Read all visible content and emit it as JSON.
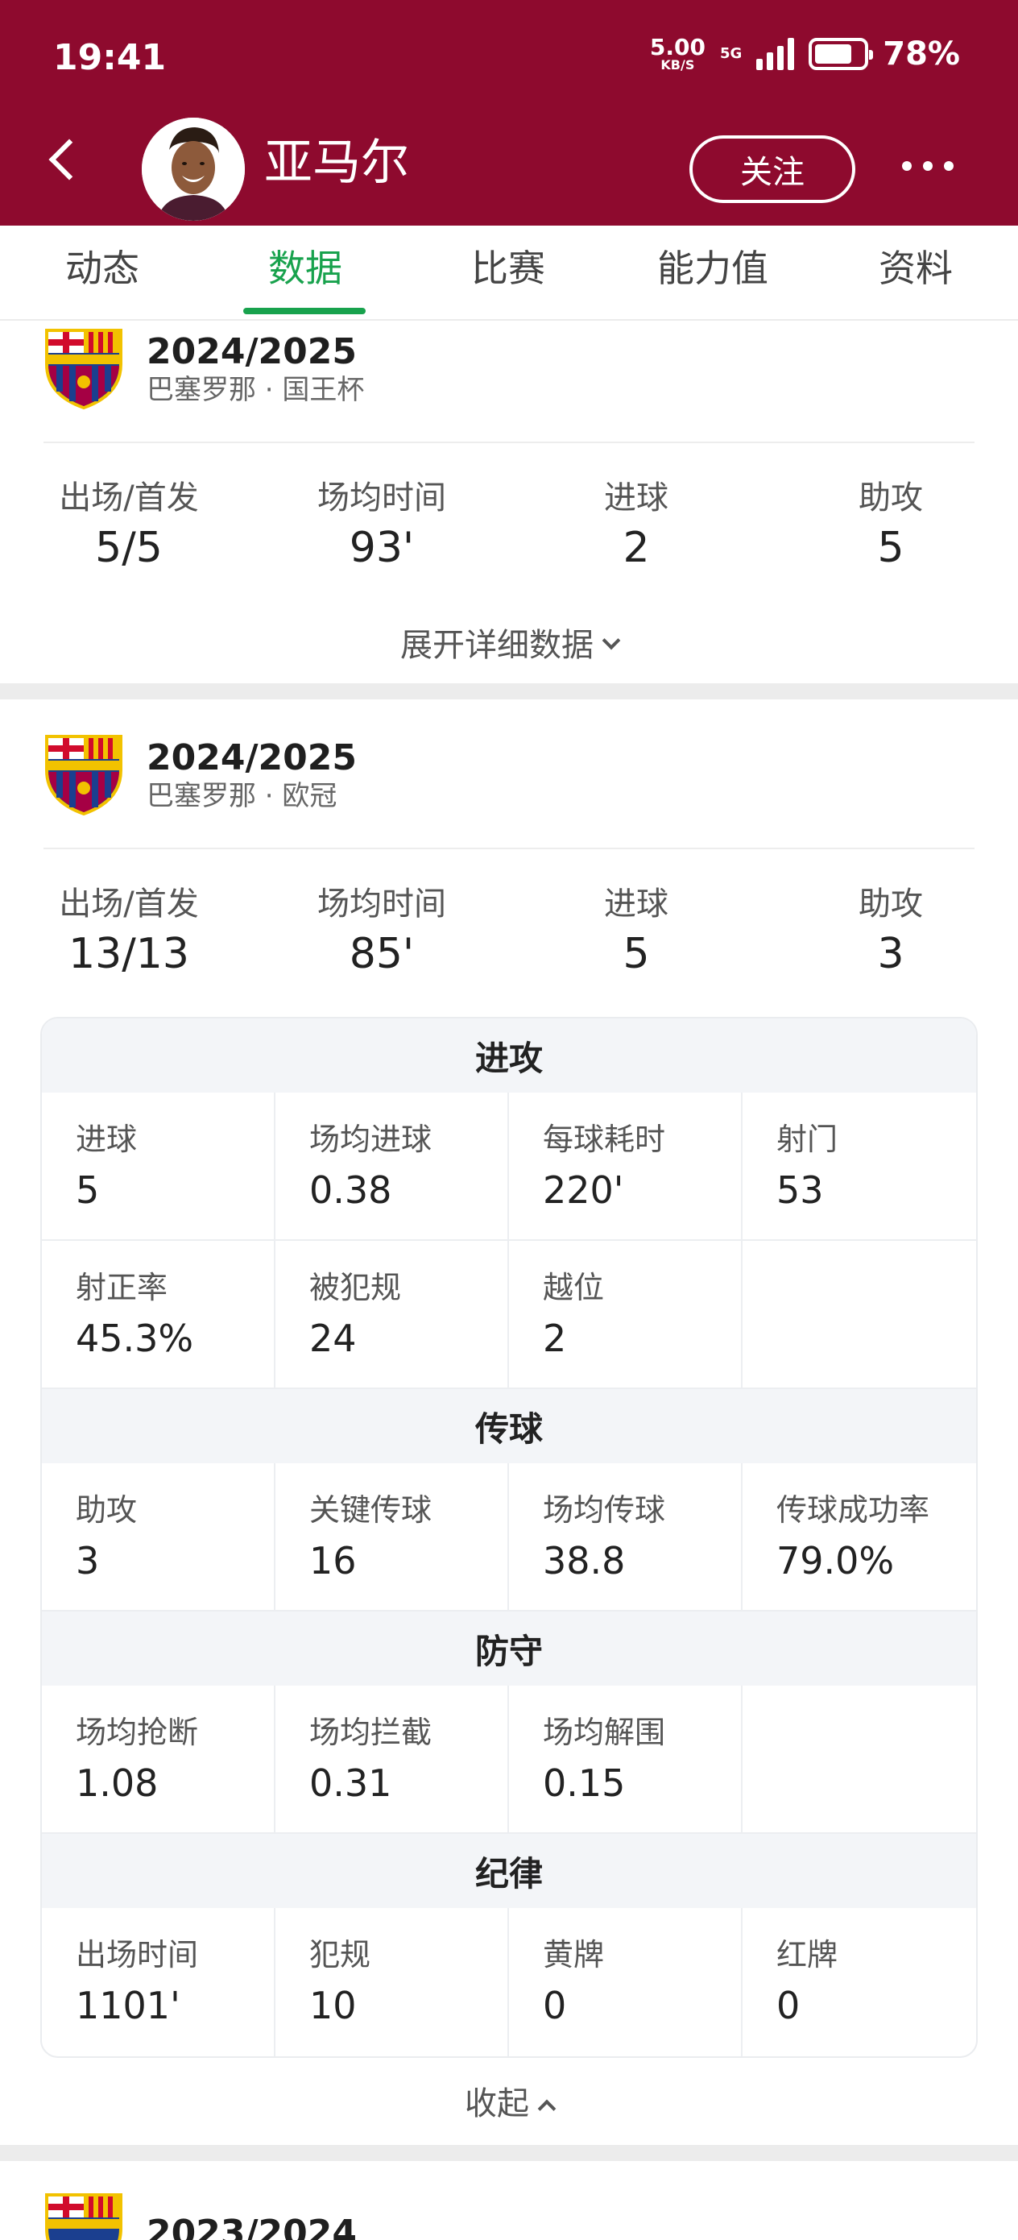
{
  "status_bar": {
    "time": "19:41",
    "net_speed": "5.00",
    "net_unit": "KB/S",
    "net_type": "5G",
    "battery_pct": "78%",
    "battery_level": 0.78
  },
  "header": {
    "player_name": "亚马尔",
    "follow_label": "关注"
  },
  "tabs": [
    {
      "label": "动态"
    },
    {
      "label": "数据"
    },
    {
      "label": "比赛"
    },
    {
      "label": "能力值"
    },
    {
      "label": "资料"
    }
  ],
  "active_tab": "数据",
  "cards": [
    {
      "season": "2024/2025",
      "competition": "巴塞罗那 · 国王杯",
      "summary": [
        {
          "label": "出场/首发",
          "value": "5/5"
        },
        {
          "label": "场均时间",
          "value": "93'"
        },
        {
          "label": "进球",
          "value": "2"
        },
        {
          "label": "助攻",
          "value": "5"
        }
      ],
      "toggle_label": "展开详细数据"
    },
    {
      "season": "2024/2025",
      "competition": "巴塞罗那 · 欧冠",
      "summary": [
        {
          "label": "出场/首发",
          "value": "13/13"
        },
        {
          "label": "场均时间",
          "value": "85'"
        },
        {
          "label": "进球",
          "value": "5"
        },
        {
          "label": "助攻",
          "value": "3"
        }
      ],
      "sections": [
        {
          "title": "进攻",
          "items": [
            {
              "label": "进球",
              "value": "5"
            },
            {
              "label": "场均进球",
              "value": "0.38"
            },
            {
              "label": "每球耗时",
              "value": "220'"
            },
            {
              "label": "射门",
              "value": "53"
            },
            {
              "label": "射正率",
              "value": "45.3%"
            },
            {
              "label": "被犯规",
              "value": "24"
            },
            {
              "label": "越位",
              "value": "2"
            }
          ]
        },
        {
          "title": "传球",
          "items": [
            {
              "label": "助攻",
              "value": "3"
            },
            {
              "label": "关键传球",
              "value": "16"
            },
            {
              "label": "场均传球",
              "value": "38.8"
            },
            {
              "label": "传球成功率",
              "value": "79.0%"
            }
          ]
        },
        {
          "title": "防守",
          "items": [
            {
              "label": "场均抢断",
              "value": "1.08"
            },
            {
              "label": "场均拦截",
              "value": "0.31"
            },
            {
              "label": "场均解围",
              "value": "0.15"
            }
          ]
        },
        {
          "title": "纪律",
          "items": [
            {
              "label": "出场时间",
              "value": "1101'"
            },
            {
              "label": "犯规",
              "value": "10"
            },
            {
              "label": "黄牌",
              "value": "0"
            },
            {
              "label": "红牌",
              "value": "0"
            }
          ]
        }
      ],
      "toggle_label": "收起"
    },
    {
      "season": "2023/2024"
    }
  ],
  "colors": {
    "header_bg": "#8e0a2e",
    "accent_green": "#18a24d",
    "crest_blue": "#1b3f8f",
    "crest_red": "#a50044",
    "crest_yellow": "#f2c200"
  }
}
